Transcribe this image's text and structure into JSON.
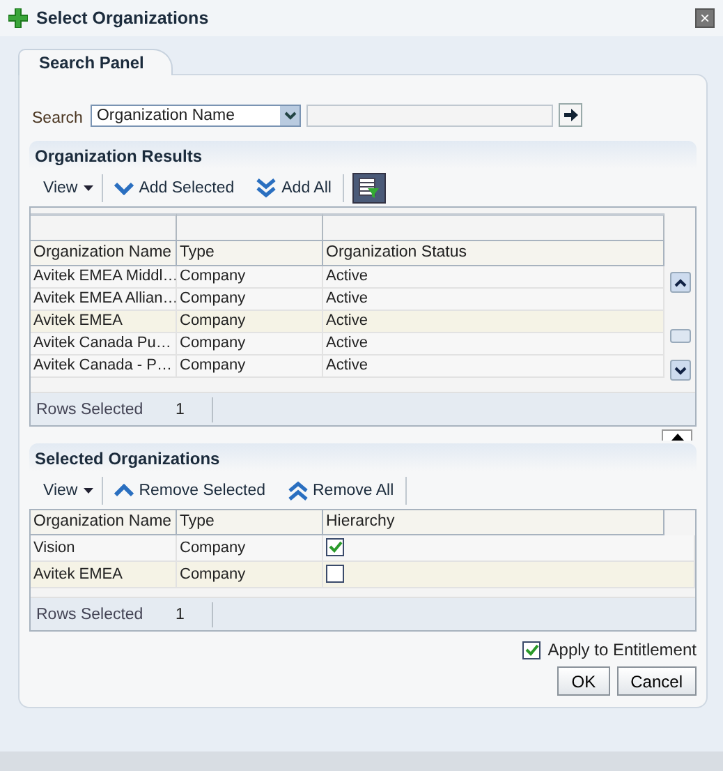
{
  "dialog": {
    "title": "Select Organizations",
    "close": "×"
  },
  "tabs": [
    {
      "label": "Search Panel",
      "selected": true
    }
  ],
  "search": {
    "label": "Search",
    "field": "Organization Name"
  },
  "results": {
    "title": "Organization Results",
    "toolbar": [
      {
        "kind": "menu",
        "label": "View"
      },
      {
        "kind": "single",
        "label": "Add Selected"
      },
      {
        "kind": "double",
        "label": "Add All"
      }
    ],
    "columns": [
      "Organization Name",
      "Type",
      "Organization Status"
    ],
    "rows": [
      {
        "cells": [
          "Avitek EMEA Middl…",
          "Company",
          "Active"
        ],
        "selected": false
      },
      {
        "cells": [
          "Avitek EMEA Allian…",
          "Company",
          "Active"
        ],
        "selected": false
      },
      {
        "cells": [
          "Avitek EMEA",
          "Company",
          "Active"
        ],
        "selected": true
      },
      {
        "cells": [
          "Avitek Canada Pu…",
          "Company",
          "Active"
        ],
        "selected": false
      },
      {
        "cells": [
          "Avitek Canada - P…",
          "Company",
          "Active"
        ],
        "selected": false
      }
    ],
    "footer_label": "Rows Selected",
    "footer_count": "1"
  },
  "selected_orgs": {
    "title": "Selected Organizations",
    "toolbar": [
      {
        "kind": "menu",
        "label": "View"
      },
      {
        "kind": "single",
        "label": "Remove Selected"
      },
      {
        "kind": "double",
        "label": "Remove All"
      }
    ],
    "columns": [
      "Organization Name",
      "Type",
      "Hierarchy"
    ],
    "rows": [
      {
        "name": "Vision",
        "type": "Company",
        "hierarchy": true,
        "selected": false
      },
      {
        "name": "Avitek EMEA",
        "type": "Company",
        "hierarchy": false,
        "selected": true
      }
    ],
    "footer_label": "Rows Selected",
    "footer_count": "1"
  },
  "apply": {
    "label": "Apply to Entitlement",
    "checked": true
  },
  "buttons": [
    "OK",
    "Cancel"
  ]
}
